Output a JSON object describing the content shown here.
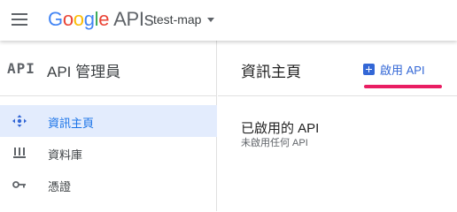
{
  "topbar": {
    "logo": {
      "letters": [
        "G",
        "o",
        "o",
        "g",
        "l",
        "e"
      ],
      "suffix": "APIs"
    },
    "project": "test-map"
  },
  "sidebar": {
    "logo_text": "API",
    "title": "API 管理員",
    "items": [
      {
        "label": "資訊主頁",
        "icon": "dashboard-icon",
        "active": true
      },
      {
        "label": "資料庫",
        "icon": "library-icon",
        "active": false
      },
      {
        "label": "憑證",
        "icon": "key-icon",
        "active": false
      }
    ]
  },
  "main": {
    "title": "資訊主頁",
    "enable_button": "啟用 API",
    "section_title": "已啟用的 API",
    "section_subtitle": "未啟用任何 API"
  },
  "colors": {
    "accent": "#3367d6",
    "active_bg": "#e3ecfd",
    "highlight": "#e91e63"
  }
}
